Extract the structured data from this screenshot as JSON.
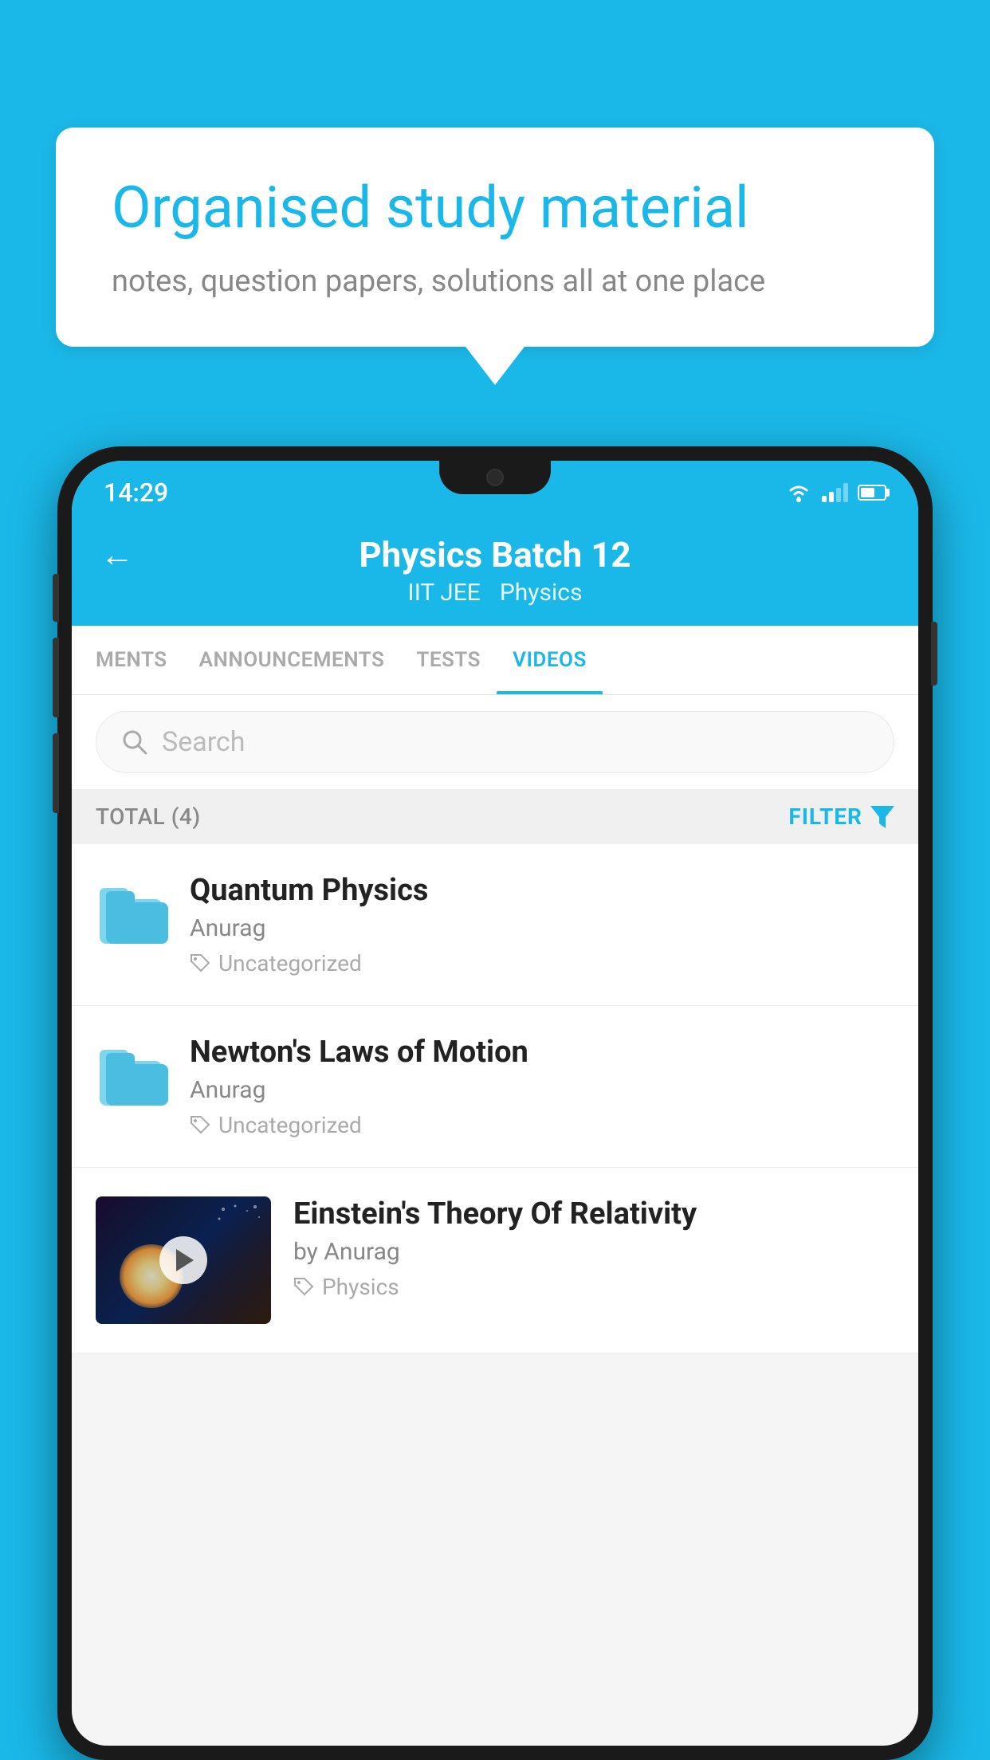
{
  "background_color": "#1AB8E8",
  "speech_bubble": {
    "title": "Organised study material",
    "subtitle": "notes, question papers, solutions all at one place"
  },
  "status_bar": {
    "time": "14:29",
    "wifi_icon": "wifi-icon",
    "signal_icon": "signal-icon",
    "battery_icon": "battery-icon"
  },
  "app_header": {
    "back_label": "←",
    "title": "Physics Batch 12",
    "subtitle_left": "IIT JEE",
    "subtitle_right": "Physics"
  },
  "tabs": [
    {
      "label": "MENTS",
      "active": false
    },
    {
      "label": "ANNOUNCEMENTS",
      "active": false
    },
    {
      "label": "TESTS",
      "active": false
    },
    {
      "label": "VIDEOS",
      "active": true
    }
  ],
  "search": {
    "placeholder": "Search"
  },
  "filter_bar": {
    "total_label": "TOTAL (4)",
    "filter_label": "FILTER"
  },
  "videos": [
    {
      "title": "Quantum Physics",
      "author": "Anurag",
      "tag": "Uncategorized",
      "type": "folder"
    },
    {
      "title": "Newton's Laws of Motion",
      "author": "Anurag",
      "tag": "Uncategorized",
      "type": "folder"
    },
    {
      "title": "Einstein's Theory Of Relativity",
      "author": "by Anurag",
      "tag": "Physics",
      "type": "video"
    }
  ]
}
